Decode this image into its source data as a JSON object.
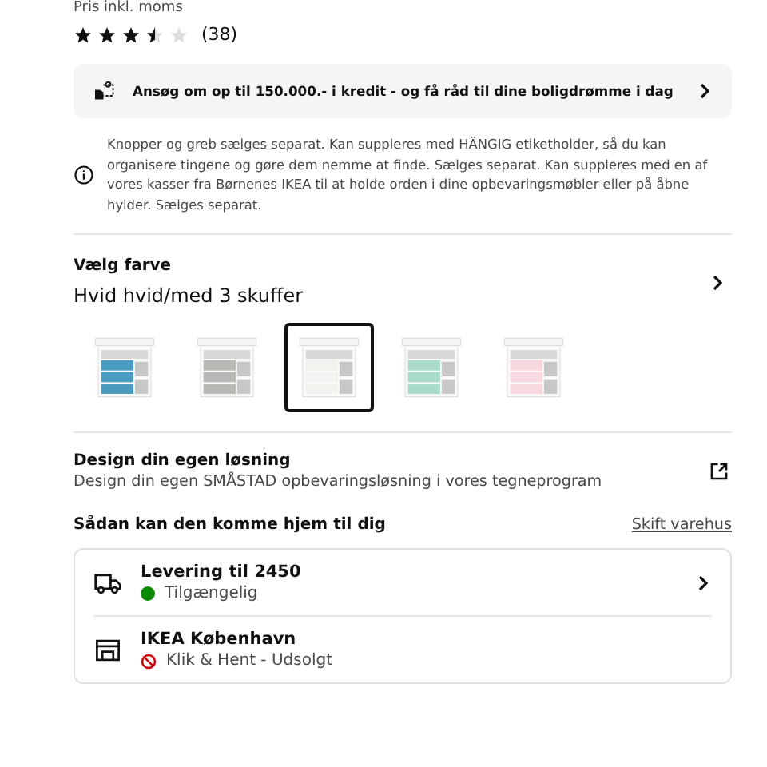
{
  "price_note": "Pris inkl. moms",
  "rating": {
    "stars": 3.5,
    "count": "(38)"
  },
  "credit_banner": {
    "text": "Ansøg om op til 150.000.- i kredit - og få råd til dine boligdrømme i dag"
  },
  "info_note": "Knopper og greb sælges separat. Kan suppleres med HÄNGIG etiketholder, så du kan organisere tingene og gøre dem nemme at finde. Sælges separat. Kan suppleres med en af vores kasser fra Børnenes IKEA til at holde orden i dine opbevaringsmøbler eller på åbne hylder. Sælges separat.",
  "color_picker": {
    "heading": "Vælg farve",
    "current": "Hvid hvid/med 3 skuffer",
    "swatches": [
      {
        "color": "#4a9cc0",
        "selected": false
      },
      {
        "color": "#b8b8b4",
        "selected": false
      },
      {
        "color": "#f2f2ee",
        "selected": true
      },
      {
        "color": "#a8dcc8",
        "selected": false
      },
      {
        "color": "#f6d8de",
        "selected": false
      }
    ]
  },
  "design": {
    "title": "Design din egen løsning",
    "subtitle": "Design din egen SMÅSTAD opbevaringsløsning i vores tegneprogram"
  },
  "delivery": {
    "heading": "Sådan kan den komme hjem til dig",
    "link": "Skift varehus",
    "options": [
      {
        "kind": "delivery",
        "title": "Levering til 2450",
        "status": "Tilgængelig",
        "available": true
      },
      {
        "kind": "store",
        "title": "IKEA København",
        "status": "Klik & Hent - Udsolgt",
        "available": false
      }
    ]
  }
}
